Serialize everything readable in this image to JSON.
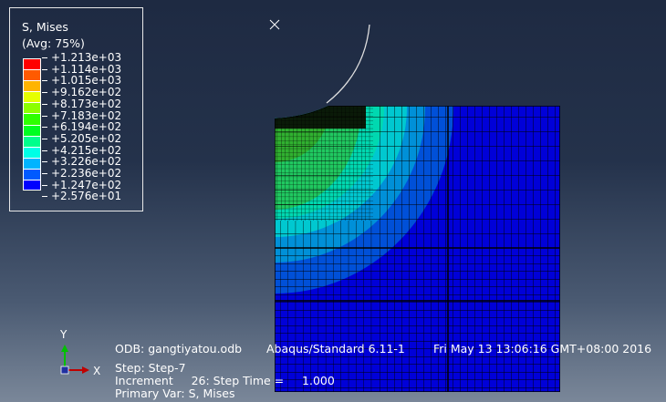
{
  "legend": {
    "title": "S, Mises",
    "subtitle": "(Avg: 75%)",
    "values": [
      "+1.213e+03",
      "+1.114e+03",
      "+1.015e+03",
      "+9.162e+02",
      "+8.173e+02",
      "+7.183e+02",
      "+6.194e+02",
      "+5.205e+02",
      "+4.215e+02",
      "+3.226e+02",
      "+2.236e+02",
      "+1.247e+02",
      "+2.576e+01"
    ],
    "colors": [
      "#ff0000",
      "#ff5a00",
      "#ffb400",
      "#e6ff00",
      "#8cff00",
      "#2eff00",
      "#00ff20",
      "#00ff8c",
      "#00ffe6",
      "#00b4ff",
      "#005aff",
      "#0000ff"
    ]
  },
  "info": {
    "odb": "ODB: gangtiyatou.odb",
    "solver": "Abaqus/Standard 6.11-1",
    "date": "Fri May 13 13:06:16 GMT+08:00 2016",
    "step": "Step: Step-7",
    "increment": "Increment     26: Step Time =     1.000",
    "primary_var": "Primary Var: S, Mises"
  },
  "triad": {
    "x": "X",
    "y": "Y"
  }
}
